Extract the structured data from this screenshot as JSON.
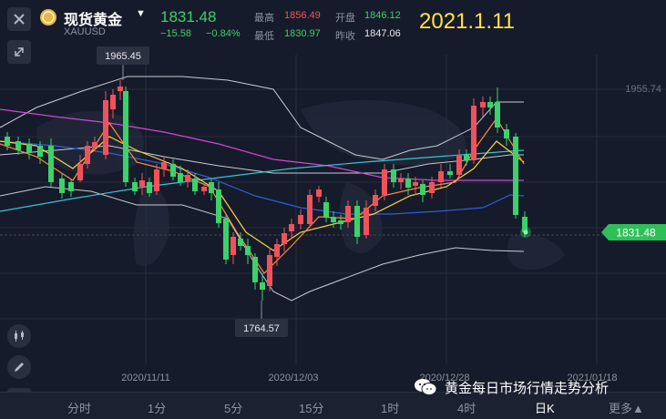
{
  "header": {
    "title": "现货黄金",
    "symbol": "XAUUSD",
    "price": "1831.48",
    "change": "−15.58",
    "change_pct": "−0.84%",
    "high_label": "最高",
    "high": "1856.49",
    "low_label": "最低",
    "low": "1830.97",
    "open_label": "开盘",
    "open": "1846.12",
    "prev_label": "昨收",
    "prev": "1847.06",
    "date_stamp": "2021.1.11"
  },
  "chart_labels": {
    "max_label": "1965.45",
    "min_label": "1764.57",
    "right_axis_top": "1955.74",
    "current_price_tag": "1831.48",
    "x_ticks": [
      "2020/11/11",
      "2020/12/03",
      "2020/12/28",
      "2021/01/18"
    ]
  },
  "tabs": [
    "分时",
    "1分",
    "5分",
    "15分",
    "1时",
    "4时",
    "日K",
    "更多▲"
  ],
  "active_tab": "日K",
  "watermark": "黄金每日市场行情走势分析",
  "colors": {
    "up": "#f0525b",
    "down": "#3dd16a",
    "accent_yellow": "#ffe14a",
    "background": "#161b2b"
  },
  "icons": [
    "close-icon",
    "gold-coin-icon",
    "dropdown-arrow-icon",
    "expand-icon",
    "candlestick-tool-icon",
    "pen-icon",
    "indicator-icon",
    "wechat-icon"
  ]
}
